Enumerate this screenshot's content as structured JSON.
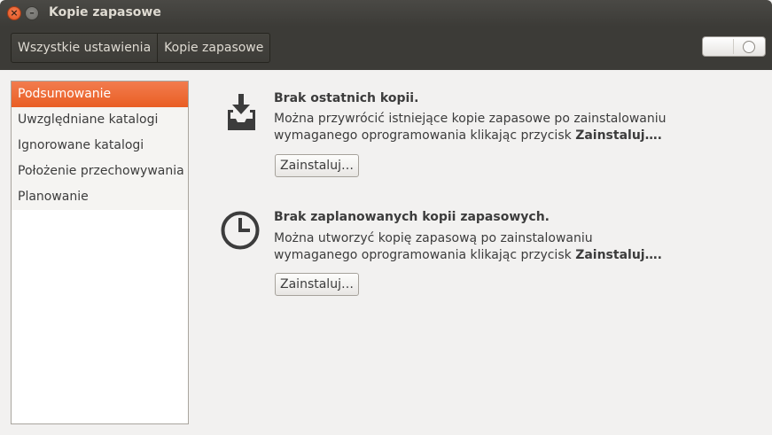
{
  "window": {
    "title": "Kopie zapasowe"
  },
  "icons": {
    "close": "close-icon",
    "minimize": "minimize-icon",
    "download": "download-tray-icon",
    "clock": "clock-icon"
  },
  "breadcrumb": {
    "all_settings": "Wszystkie ustawienia",
    "current": "Kopie zapasowe"
  },
  "toggle": {
    "state": "off"
  },
  "sidebar": {
    "items": [
      {
        "label": "Podsumowanie",
        "selected": true
      },
      {
        "label": "Uwzględniane katalogi"
      },
      {
        "label": "Ignorowane katalogi"
      },
      {
        "label": "Położenie przechowywania"
      },
      {
        "label": "Planowanie"
      }
    ]
  },
  "sections": [
    {
      "heading": "Brak ostatnich kopii.",
      "line1": "Można przywrócić istniejące kopie zapasowe po zainstalowaniu",
      "line2_prefix": "wymaganego oprogramowania klikając przycisk ",
      "line2_bold": "Zainstaluj…",
      "line2_suffix": ".",
      "button": "Zainstaluj…"
    },
    {
      "heading": "Brak zaplanowanych kopii zapasowych.",
      "line1": "Można utworzyć kopię zapasową po zainstalowaniu",
      "line2_prefix": "wymaganego oprogramowania klikając przycisk ",
      "line2_bold": "Zainstaluj…",
      "line2_suffix": ".",
      "button": "Zainstaluj…"
    }
  ],
  "colors": {
    "accent": "#e95e24",
    "titlebar": "#3c3b37",
    "background": "#f2f1f0"
  }
}
